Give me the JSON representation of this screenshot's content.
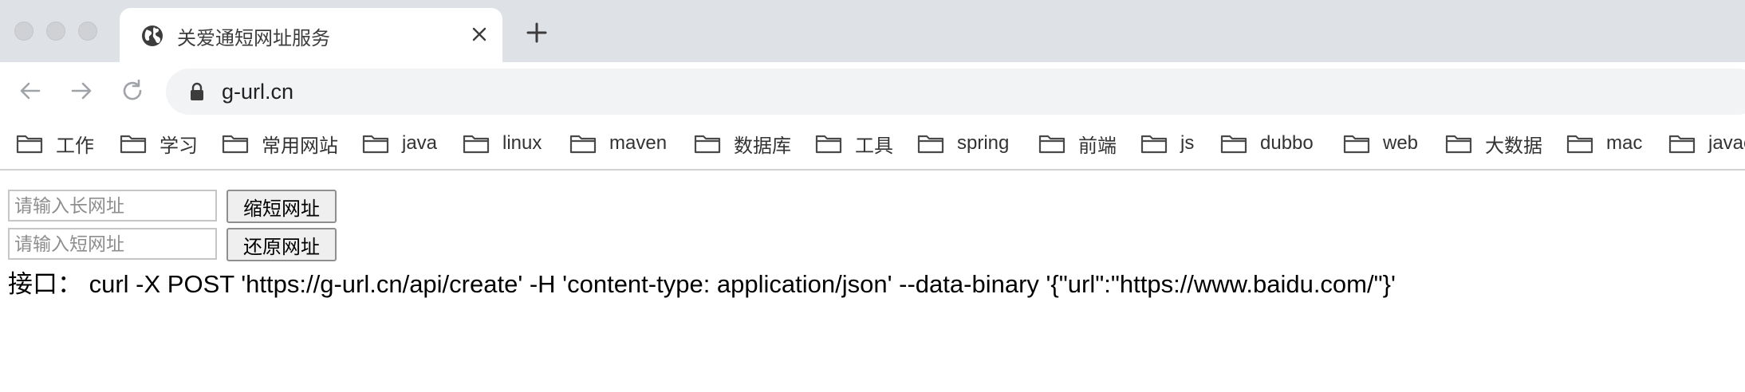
{
  "browser": {
    "tab": {
      "title": "关爱通短网址服务",
      "icon": "globe-icon"
    },
    "new_tab_label": "+",
    "address": {
      "url": "g-url.cn",
      "icon": "lock-icon"
    }
  },
  "bookmarks": [
    {
      "label": "工作"
    },
    {
      "label": "学习"
    },
    {
      "label": "常用网站"
    },
    {
      "label": "java"
    },
    {
      "label": "linux"
    },
    {
      "label": "maven"
    },
    {
      "label": "数据库"
    },
    {
      "label": "工具"
    },
    {
      "label": "spring"
    },
    {
      "label": "前端"
    },
    {
      "label": "js"
    },
    {
      "label": "dubbo"
    },
    {
      "label": "web"
    },
    {
      "label": "大数据"
    },
    {
      "label": "mac"
    },
    {
      "label": "javaee"
    }
  ],
  "page": {
    "shorten": {
      "placeholder": "请输入长网址",
      "button": "缩短网址"
    },
    "restore": {
      "placeholder": "请输入短网址",
      "button": "还原网址"
    },
    "api_text": "接口： curl -X POST 'https://g-url.cn/api/create' -H 'content-type: application/json' --data-binary '{\"url\":\"https://www.baidu.com/\"}'"
  },
  "colors": {
    "chrome_bg": "#dee1e6",
    "omnibox_bg": "#f1f3f4",
    "button_bg": "#efefef"
  }
}
